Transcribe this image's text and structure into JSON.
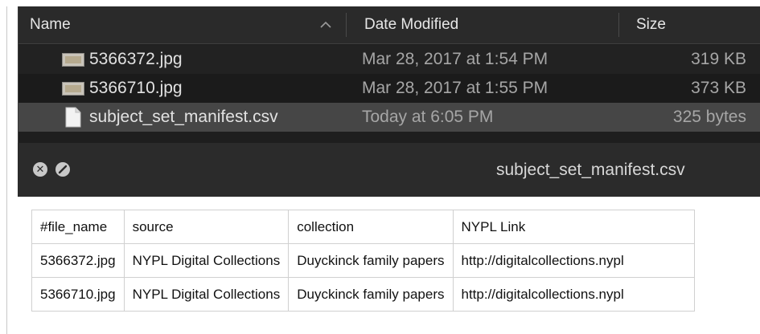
{
  "finder": {
    "columns": {
      "name": "Name",
      "date": "Date Modified",
      "size": "Size"
    },
    "files": [
      {
        "name": "5366372.jpg",
        "date": "Mar 28, 2017 at 1:54 PM",
        "size": "319 KB",
        "icon": "image-file-icon"
      },
      {
        "name": "5366710.jpg",
        "date": "Mar 28, 2017 at 1:55 PM",
        "size": "373 KB",
        "icon": "image-file-icon"
      },
      {
        "name": "subject_set_manifest.csv",
        "date": "Today at 6:05 PM",
        "size": "325 bytes",
        "icon": "document-file-icon",
        "selected": true
      }
    ]
  },
  "viewer": {
    "title": "subject_set_manifest.csv",
    "table": {
      "header": [
        "#file_name",
        "source",
        "collection",
        "NYPL Link"
      ],
      "rows": [
        [
          "5366372.jpg",
          "NYPL Digital Collections",
          "Duyckinck family papers",
          "http://digitalcollections.nypl"
        ],
        [
          "5366710.jpg",
          "NYPL Digital Collections",
          "Duyckinck family papers",
          "http://digitalcollections.nypl"
        ]
      ]
    }
  },
  "colors": {
    "finder_bg": "#1e1e1e",
    "selected_row": "#464646",
    "viewer_titlebar": "#2b2b2b"
  }
}
